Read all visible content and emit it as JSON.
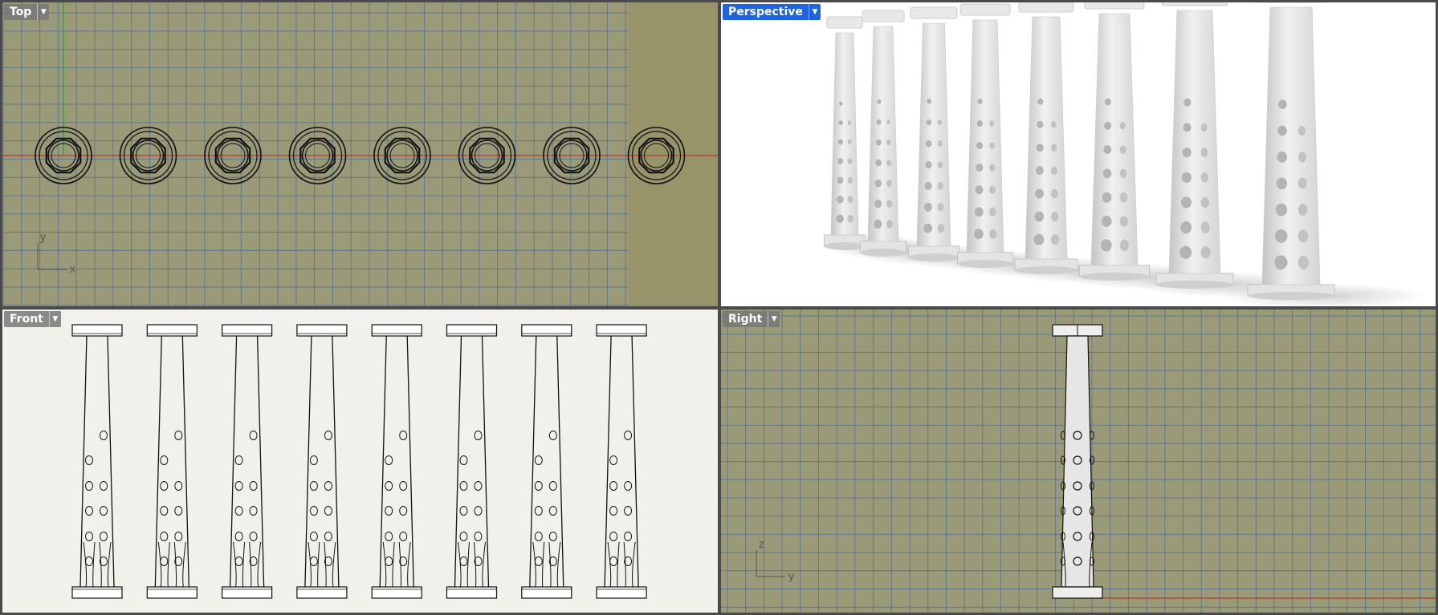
{
  "viewports": {
    "top": {
      "title": "Top"
    },
    "perspective": {
      "title": "Perspective"
    },
    "front": {
      "title": "Front"
    },
    "right": {
      "title": "Right"
    }
  },
  "axes": {
    "top": {
      "x": "x",
      "y": "y"
    },
    "right": {
      "y": "y",
      "z": "z"
    }
  },
  "icons": {
    "dropdown": "chevron-down-icon"
  },
  "colors": {
    "grid_bg": "#9a9a78",
    "grid_line": "#4f6d8c",
    "x_axis": "#b33a2a",
    "y_axis": "#2aa02a",
    "active_tab": "#1f63e0"
  },
  "column_count": 8
}
